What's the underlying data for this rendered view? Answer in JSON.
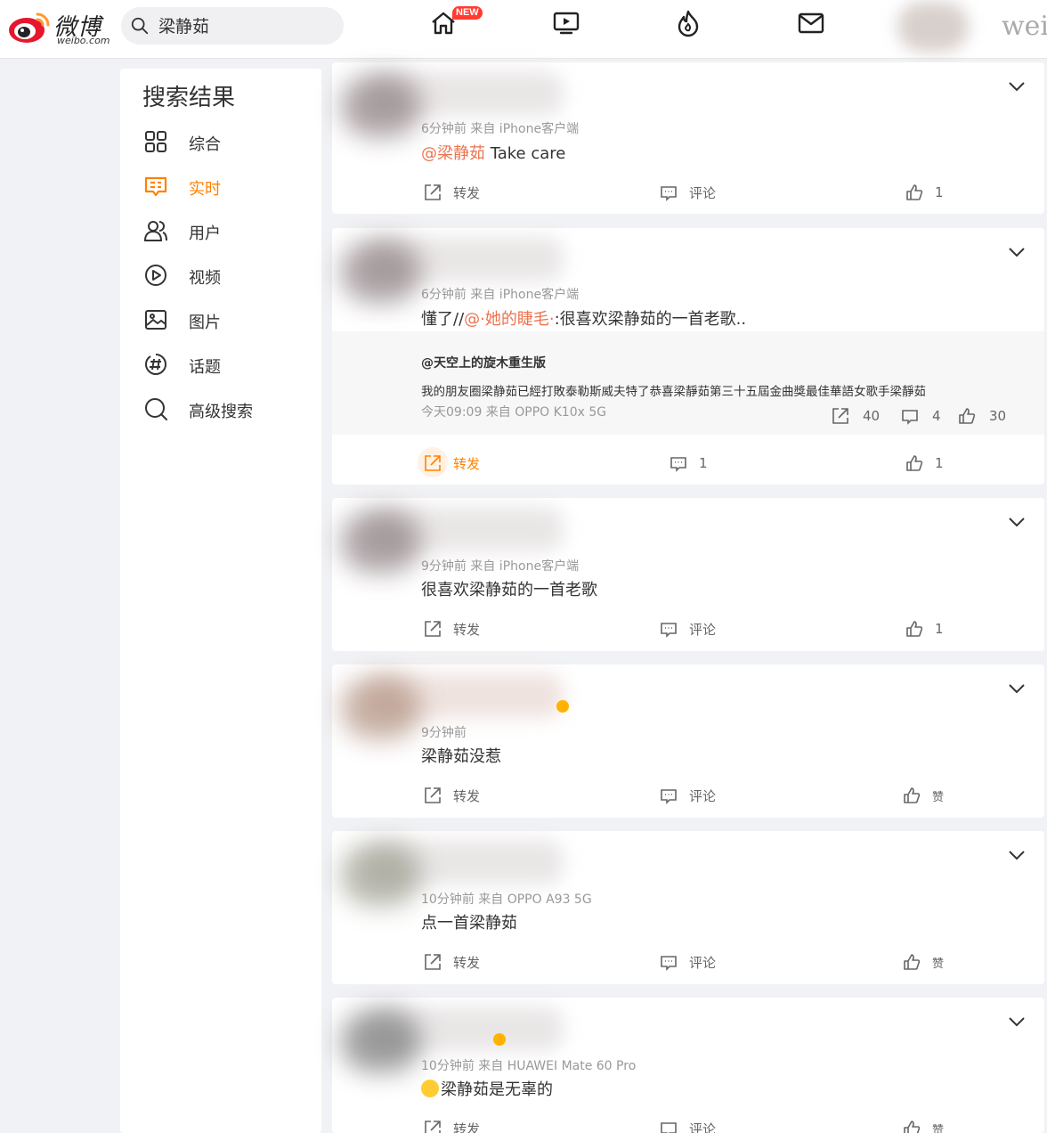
{
  "header": {
    "logo_text": "微博",
    "logo_domain": "weibo.com",
    "search_value": "梁静茹",
    "new_badge": "NEW",
    "right_text": "wei",
    "nav_icons": [
      "home-icon",
      "video-icon",
      "hot-icon",
      "mail-icon"
    ]
  },
  "sidebar": {
    "title": "搜索结果",
    "items": [
      {
        "label": "综合",
        "icon": "grid-icon"
      },
      {
        "label": "实时",
        "icon": "realtime-icon",
        "active": true
      },
      {
        "label": "用户",
        "icon": "users-icon"
      },
      {
        "label": "视频",
        "icon": "play-icon"
      },
      {
        "label": "图片",
        "icon": "image-icon"
      },
      {
        "label": "话题",
        "icon": "hashtag-icon"
      },
      {
        "label": "高级搜索",
        "icon": "search-icon"
      }
    ]
  },
  "posts": [
    {
      "meta": "6分钟前  来自 iPhone客户端",
      "mention": "@梁静茹",
      "text": " Take care",
      "repost": "转发",
      "comment": "评论",
      "like": "1"
    },
    {
      "meta": "6分钟前  来自 iPhone客户端",
      "text_pre": "懂了//",
      "mention": "@·她的睫毛·",
      "text": ":很喜欢梁静茹的一首老歌..",
      "retweet": {
        "user": "@天空上的旋木重生版",
        "text": "我的朋友圈梁静茹已經打敗泰勒斯威夫特了恭喜梁靜茹第三十五屆金曲獎最佳華語女歌手梁靜茹",
        "meta": "今天09:09 来自 OPPO K10x 5G",
        "reposts": "40",
        "comments": "4",
        "likes": "30"
      },
      "repost": "转发",
      "comment": "1",
      "like": "1"
    },
    {
      "meta": "9分钟前  来自 iPhone客户端",
      "text": "很喜欢梁静茹的一首老歌",
      "repost": "转发",
      "comment": "评论",
      "like": "1"
    },
    {
      "meta": "9分钟前",
      "text": "梁静茹没惹",
      "repost": "转发",
      "comment": "评论",
      "like": "赞"
    },
    {
      "meta": "10分钟前  来自 OPPO A93 5G",
      "text": "点一首梁静茹",
      "repost": "转发",
      "comment": "评论",
      "like": "赞"
    },
    {
      "meta": "10分钟前  来自 HUAWEI Mate 60 Pro",
      "text": "梁静茹是无辜的",
      "repost": "转发",
      "comment": "评论",
      "like": "赞"
    }
  ],
  "colors": {
    "accent": "#ff8200",
    "mention": "#eb7350",
    "background": "#f1f2f5"
  }
}
